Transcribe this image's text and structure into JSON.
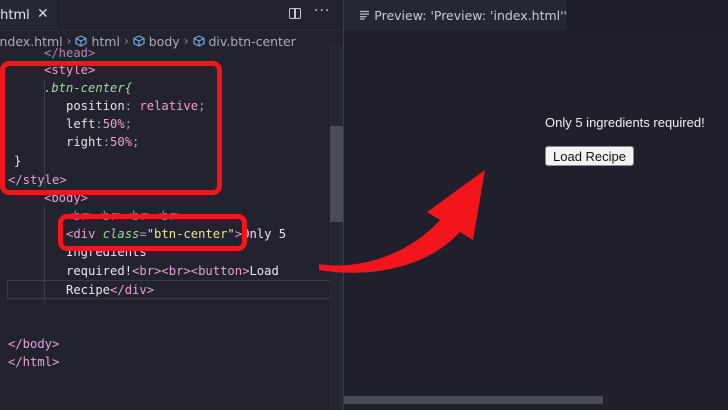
{
  "editor": {
    "tab_label": ".html",
    "close_glyph": "✕",
    "more_glyph": "···",
    "breadcrumb": [
      "index.html",
      "html",
      "body",
      "div.btn-center"
    ],
    "breadcrumb_sep": "›",
    "lines": {
      "l0_tag": "</head>",
      "l1": "<style>",
      "l2": ".btn-center{",
      "l3_prop": "position",
      "l3_val": "relative",
      "l4_prop": "left",
      "l4_val": "50%",
      "l5_prop": "right",
      "l5_val": "50%",
      "l6": "}",
      "l7": "</style>",
      "l8": "<body>",
      "l9": "<br><br><br><br>",
      "l10_open": "<div ",
      "l10_attr": "class",
      "l10_str": "\"btn-center\"",
      "l10_close": ">",
      "l10_text": "Only 5",
      "l11": "Ingredients",
      "l12_text": "required!",
      "l12_tags": "<br><br><button>",
      "l12_tail": "Load",
      "l13_text": "Recipe",
      "l13_tag": "</div>",
      "l14": "</body>",
      "l15": "</html>"
    }
  },
  "preview": {
    "tab_label": "Preview: 'Preview: 'index.html''",
    "text": "Only 5 ingredients required!",
    "button_label": "Load Recipe"
  },
  "icons": {
    "preview_tab": "preview-lines-icon",
    "breadcrumb": "cube-icon",
    "split": "split-editor-icon",
    "more": "more-actions-icon",
    "close": "close-icon"
  },
  "colors": {
    "highlight": "#f2161c",
    "editor_bg": "#22232f",
    "preview_bg": "#1f202c"
  }
}
